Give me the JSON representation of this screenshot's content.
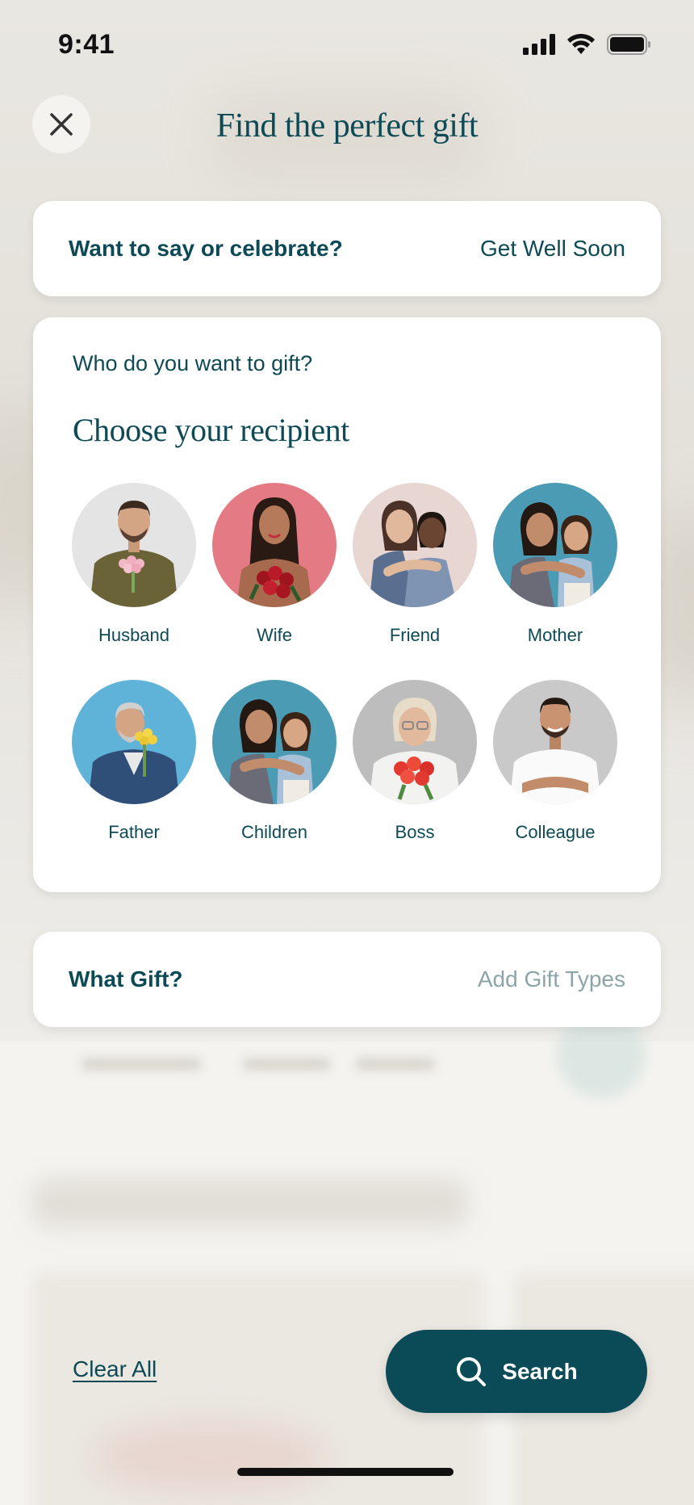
{
  "status_bar": {
    "time": "9:41",
    "icons": [
      "cellular-signal-icon",
      "wifi-icon",
      "battery-icon"
    ]
  },
  "header": {
    "title": "Find the perfect gift",
    "close_icon": "close-icon"
  },
  "occasion": {
    "label": "Want to say or celebrate?",
    "value": "Get Well Soon"
  },
  "recipient": {
    "question": "Who do you want to gift?",
    "heading": "Choose your recipient",
    "options": [
      {
        "label": "Husband",
        "bg": "#e6e6e6"
      },
      {
        "label": "Wife",
        "bg": "#e47b84"
      },
      {
        "label": "Friend",
        "bg": "#e8d6d3"
      },
      {
        "label": "Mother",
        "bg": "#4a9bb3"
      },
      {
        "label": "Father",
        "bg": "#5fb3d8"
      },
      {
        "label": "Children",
        "bg": "#4a9bb3"
      },
      {
        "label": "Boss",
        "bg": "#bdbdbd"
      },
      {
        "label": "Colleague",
        "bg": "#c9c9c9"
      }
    ]
  },
  "gift": {
    "label": "What Gift?",
    "placeholder": "Add Gift Types"
  },
  "footer": {
    "clear_label": "Clear All",
    "search_label": "Search",
    "search_icon": "search-icon"
  },
  "colors": {
    "primary": "#0b4b58",
    "text": "#0e4a55",
    "placeholder": "#8ba5a9",
    "card": "#ffffff"
  }
}
